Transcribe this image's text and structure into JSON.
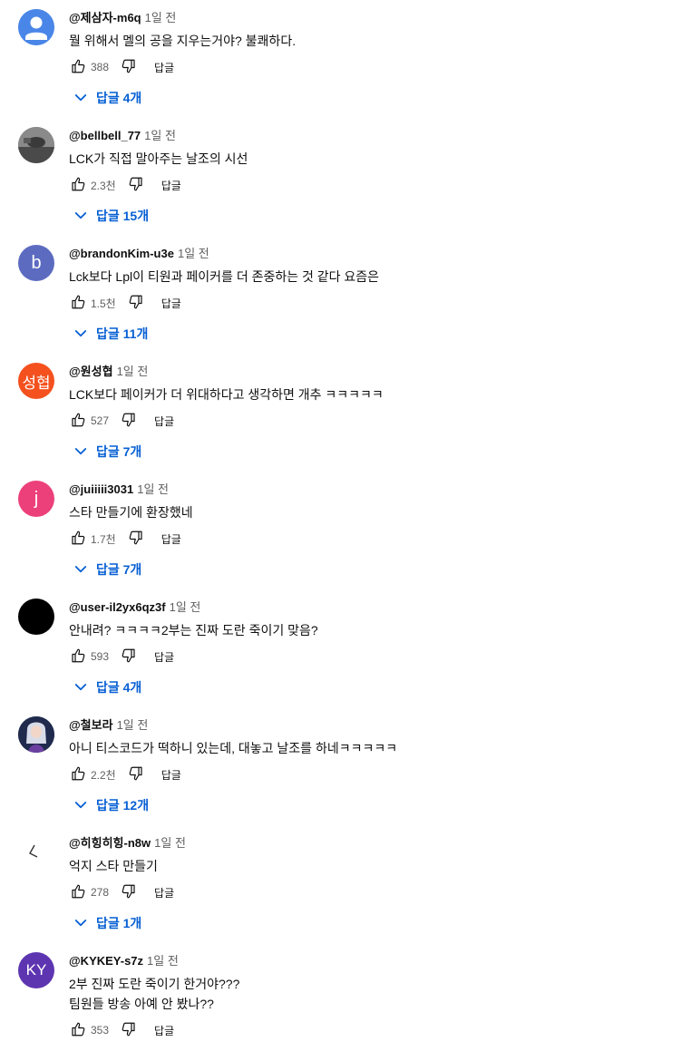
{
  "labels": {
    "reply": "답글"
  },
  "comments": [
    {
      "author": "@제삼자-m6q",
      "time": "1일 전",
      "lines": [
        "뭘 위해서 멜의 공을 지우는거야? 불쾌하다."
      ],
      "likes": "388",
      "replies": "답글 4개",
      "avatar": {
        "type": "default-person",
        "bg": "#4a86e8"
      }
    },
    {
      "author": "@bellbell_77",
      "time": "1일 전",
      "lines": [
        "LCK가 직접 말아주는 날조의 시선"
      ],
      "likes": "2.3천",
      "replies": "답글 15개",
      "avatar": {
        "type": "photo-dark",
        "bg": "#6b6b6b"
      }
    },
    {
      "author": "@brandonKim-u3e",
      "time": "1일 전",
      "lines": [
        "Lck보다 Lpl이 티원과 페이커를 더 존중하는 것 같다 요즘은"
      ],
      "likes": "1.5천",
      "replies": "답글 11개",
      "avatar": {
        "type": "letter",
        "text": "b",
        "bg": "#5c6bc0"
      }
    },
    {
      "author": "@원성협",
      "time": "1일 전",
      "lines": [
        "LCK보다 페이커가 더 위대하다고 생각하면 개추  ㅋㅋㅋㅋㅋ"
      ],
      "likes": "527",
      "replies": "답글 7개",
      "avatar": {
        "type": "letter",
        "text": "성협",
        "bg": "#f4511e"
      }
    },
    {
      "author": "@juiiiii3031",
      "time": "1일 전",
      "lines": [
        "스타 만들기에 환장했네"
      ],
      "likes": "1.7천",
      "replies": "답글 7개",
      "avatar": {
        "type": "letter",
        "text": "j",
        "bg": "#ec407a"
      }
    },
    {
      "author": "@user-il2yx6qz3f",
      "time": "1일 전",
      "lines": [
        "안내려? ㅋㅋㅋㅋ2부는 진짜 도란 죽이기 맞음?"
      ],
      "likes": "593",
      "replies": "답글 4개",
      "avatar": {
        "type": "solid",
        "bg": "#000000"
      }
    },
    {
      "author": "@철보라",
      "time": "1일 전",
      "lines": [
        "아니 티스코드가 떡하니 있는데, 대놓고 날조를 하네ㅋㅋㅋㅋㅋ"
      ],
      "likes": "2.2천",
      "replies": "답글 12개",
      "avatar": {
        "type": "photo-character",
        "bg": "#2b3a67"
      }
    },
    {
      "author": "@히힝히힝-n8w",
      "time": "1일 전",
      "lines": [
        "억지 스타 만들기"
      ],
      "likes": "278",
      "replies": "답글 1개",
      "avatar": {
        "type": "sketch",
        "bg": "#ffffff"
      }
    },
    {
      "author": "@KYKEY-s7z",
      "time": "1일 전",
      "lines": [
        "2부 진짜 도란 죽이기 한거야???",
        "팀원들 방송 아예 안 봤나??"
      ],
      "likes": "353",
      "replies": "",
      "avatar": {
        "type": "letter",
        "text": "KY",
        "bg": "#5e35b1"
      }
    }
  ]
}
